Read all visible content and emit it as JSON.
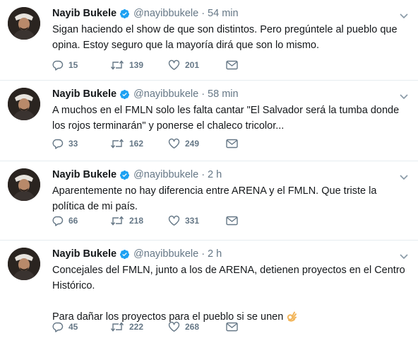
{
  "colors": {
    "accent": "#1da1f2",
    "text": "#14171a",
    "muted": "#657786",
    "divider": "#e6ecf0"
  },
  "icons": {
    "verified": "verified-badge-icon",
    "caret": "chevron-down-icon",
    "reply": "reply-icon",
    "retweet": "retweet-icon",
    "like": "heart-icon",
    "dm": "envelope-icon",
    "emoji": "ok-hand-emoji-icon"
  },
  "tweets": [
    {
      "name": "Nayib Bukele",
      "handle": "@nayibbukele",
      "separator": "·",
      "time": "54 min",
      "text": [
        "Sigan haciendo el show de que son distintos. Pero pregúntele al pueblo que opina. Estoy seguro que la mayoría dirá que son lo mismo."
      ],
      "replies": "15",
      "retweets": "139",
      "likes": "201"
    },
    {
      "name": "Nayib Bukele",
      "handle": "@nayibbukele",
      "separator": "·",
      "time": "58 min",
      "text": [
        "A muchos en el FMLN solo les falta cantar \"El Salvador será la tumba donde los rojos terminarán\" y ponerse el chaleco tricolor..."
      ],
      "replies": "33",
      "retweets": "162",
      "likes": "249"
    },
    {
      "name": "Nayib Bukele",
      "handle": "@nayibbukele",
      "separator": "·",
      "time": "2 h",
      "text": [
        "Aparentemente no hay diferencia entre ARENA y el FMLN. Que triste la política de mi país."
      ],
      "replies": "66",
      "retweets": "218",
      "likes": "331"
    },
    {
      "name": "Nayib Bukele",
      "handle": "@nayibbukele",
      "separator": "·",
      "time": "2 h",
      "text": [
        "Concejales del FMLN, junto a los de ARENA, detienen proyectos en el Centro Histórico.",
        "Para dañar los proyectos para el pueblo si se unen"
      ],
      "replies": "45",
      "retweets": "222",
      "likes": "268"
    }
  ]
}
